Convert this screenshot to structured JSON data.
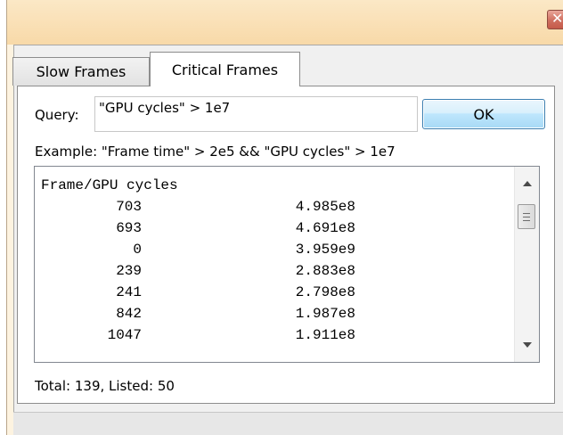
{
  "titlebar": {
    "close_icon": "close-icon",
    "close_glyph": "✕",
    "close_color": "#c55a49"
  },
  "tabs": [
    {
      "label": "Slow Frames",
      "active": false
    },
    {
      "label": "Critical Frames",
      "active": true
    }
  ],
  "query": {
    "label": "Query:",
    "value": "\"GPU cycles\" > 1e7",
    "button_label": "OK"
  },
  "example_text": "Example: \"Frame time\" > 2e5 && \"GPU cycles\" > 1e7",
  "list": {
    "header": "Frame/GPU cycles",
    "rows": [
      {
        "frame": "703",
        "gpu_cycles": "4.985e8"
      },
      {
        "frame": "693",
        "gpu_cycles": "4.691e8"
      },
      {
        "frame": "0",
        "gpu_cycles": "3.959e9"
      },
      {
        "frame": "239",
        "gpu_cycles": "2.883e8"
      },
      {
        "frame": "241",
        "gpu_cycles": "2.798e8"
      },
      {
        "frame": "842",
        "gpu_cycles": "1.987e8"
      },
      {
        "frame": "1047",
        "gpu_cycles": "1.911e8"
      }
    ]
  },
  "summary": "Total: 139, Listed: 50",
  "colors": {
    "accent": "#3c7fb1",
    "window_frame": "#fdf3e0"
  }
}
